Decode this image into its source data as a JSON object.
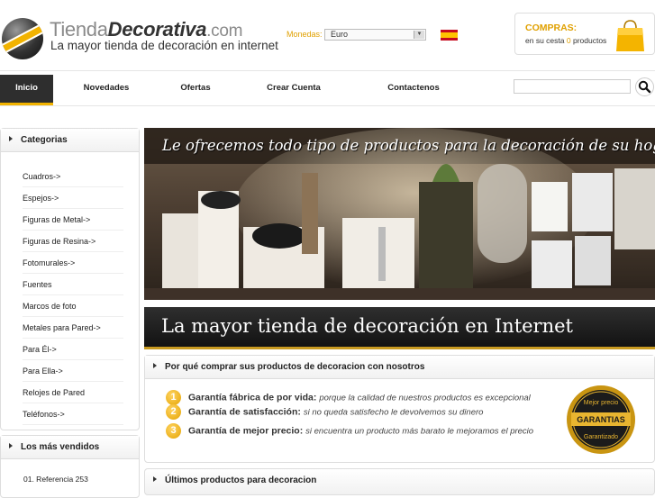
{
  "header": {
    "logo": {
      "part1": "Tienda",
      "part2": "Decorativa",
      "part3": ".com",
      "tagline": "La mayor tienda de decoración en internet"
    },
    "currency": {
      "label": "Monedas:",
      "selected": "Euro"
    },
    "language_flag": "spain-flag-icon",
    "cart": {
      "title": "COMPRAS:",
      "text_before": "en su cesta",
      "count": "0",
      "text_after": "productos"
    }
  },
  "nav": {
    "items": [
      {
        "label": "Inicio",
        "active": true
      },
      {
        "label": "Novedades"
      },
      {
        "label": "Ofertas"
      },
      {
        "label": "Crear Cuenta"
      },
      {
        "label": "Contactenos"
      }
    ],
    "search": {
      "placeholder": "",
      "icon": "search-icon"
    }
  },
  "sidebar": {
    "categories": {
      "title": "Categorias",
      "items": [
        {
          "label": "Cuadros->"
        },
        {
          "label": "Espejos->"
        },
        {
          "label": "Figuras de Metal->"
        },
        {
          "label": "Figuras de Resina->"
        },
        {
          "label": "Fotomurales->"
        },
        {
          "label": "Fuentes"
        },
        {
          "label": "Marcos de foto"
        },
        {
          "label": "Metales para Pared->"
        },
        {
          "label": "Para Él->"
        },
        {
          "label": "Para Ella->"
        },
        {
          "label": "Relojes de Pared"
        },
        {
          "label": "Teléfonos->"
        }
      ]
    },
    "bestsellers": {
      "title": "Los más vendidos",
      "items": [
        {
          "label": "01.  Referencia 253"
        }
      ]
    }
  },
  "main": {
    "banner_text": "Le ofrecemos todo tipo de productos para la decoración de su hogar !",
    "banner2_text": "La mayor tienda de decoración en Internet",
    "why": {
      "title": "Por qué comprar sus productos de decoracion con nosotros",
      "guarantees": [
        {
          "num": "1",
          "title": "Garantía fábrica de por vida:",
          "desc": "porque la calidad de nuestros productos es excepcional"
        },
        {
          "num": "2",
          "title": "Garantía de satisfacción:",
          "desc": "si no queda satisfecho le devolvemos su dinero"
        },
        {
          "num": "3",
          "title": "Garantía de mejor precio:",
          "desc": "si encuentra un producto más barato le mejoramos el precio"
        }
      ],
      "seal": {
        "top": "Mejor precio",
        "middle": "GARANTIAS",
        "bottom": "Garantizado"
      }
    },
    "latest_title": "Últimos productos para decoracion"
  },
  "colors": {
    "accent": "#f2b300",
    "cart_accent": "#e0a000",
    "nav_active_bg": "#2e2e2e"
  }
}
